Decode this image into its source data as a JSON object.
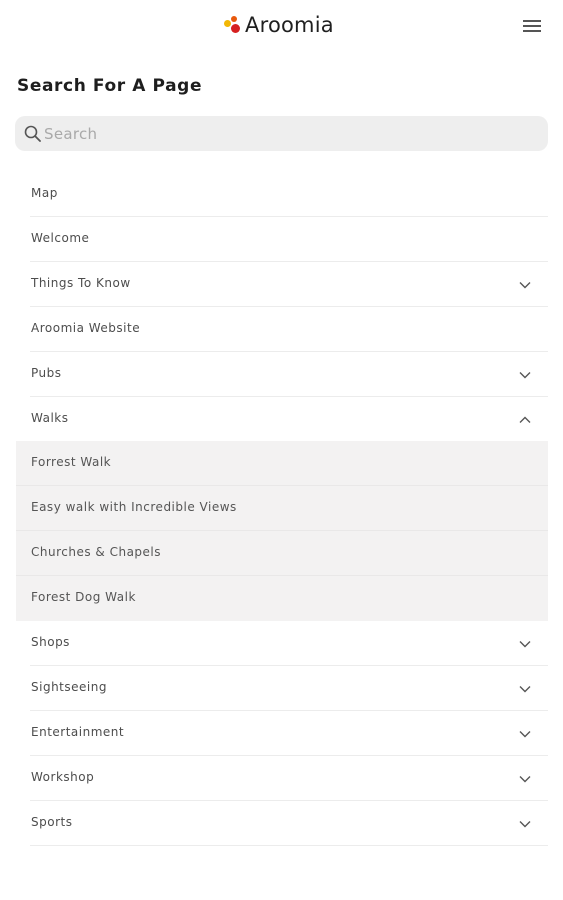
{
  "brand": {
    "name": "Aroomia",
    "dot_colors": [
      "#f2b705",
      "#e8590c",
      "#d62020"
    ]
  },
  "header": {
    "menu_icon": "hamburger-menu-icon"
  },
  "page": {
    "title": "Search For A Page"
  },
  "search": {
    "placeholder": "Search",
    "value": "",
    "icon": "search-icon"
  },
  "nav": {
    "items": [
      {
        "label": "Map",
        "expandable": false
      },
      {
        "label": "Welcome",
        "expandable": false
      },
      {
        "label": "Things To Know",
        "expandable": true,
        "expanded": false
      },
      {
        "label": "Aroomia Website",
        "expandable": false
      },
      {
        "label": "Pubs",
        "expandable": true,
        "expanded": false
      },
      {
        "label": "Walks",
        "expandable": true,
        "expanded": true,
        "children": [
          {
            "label": "Forrest Walk"
          },
          {
            "label": "Easy walk with Incredible Views"
          },
          {
            "label": "Churches & Chapels"
          },
          {
            "label": "Forest Dog Walk"
          }
        ]
      },
      {
        "label": "Shops",
        "expandable": true,
        "expanded": false
      },
      {
        "label": "Sightseeing",
        "expandable": true,
        "expanded": false
      },
      {
        "label": "Entertainment",
        "expandable": true,
        "expanded": false
      },
      {
        "label": "Workshop",
        "expandable": true,
        "expanded": false
      },
      {
        "label": "Sports",
        "expandable": true,
        "expanded": false
      }
    ]
  }
}
